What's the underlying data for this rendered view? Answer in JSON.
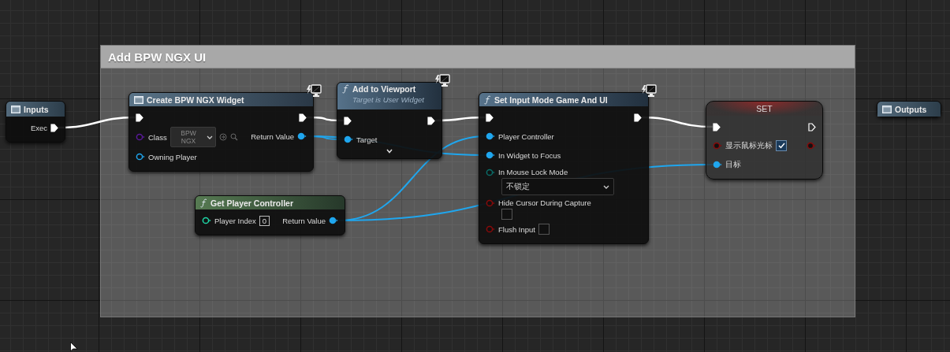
{
  "comment": {
    "title": "Add BPW NGX UI"
  },
  "nodes": [
    {
      "kind": "tunnel",
      "title": "Inputs",
      "net_icon": false,
      "outputs": [
        {
          "kind": "exec",
          "label": "Exec",
          "connected": true
        }
      ]
    },
    {
      "kind": "create_widget",
      "title": "Create BPW NGX Widget",
      "net_icon": true,
      "inputs": [
        {
          "kind": "exec",
          "connected": true
        },
        {
          "kind": "class",
          "label": "Class",
          "connected": false,
          "control": {
            "kind": "dropdown",
            "value": "BPW NGX"
          }
        },
        {
          "kind": "object",
          "label": "Owning Player",
          "connected": false
        }
      ],
      "outputs": [
        {
          "kind": "exec",
          "connected": true
        },
        {
          "kind": "object",
          "label": "Return Value",
          "connected": true
        }
      ]
    },
    {
      "kind": "function",
      "title": "Add to Viewport",
      "subtitle": "Target is User Widget",
      "net_icon": true,
      "advanced_hidden": true,
      "inputs": [
        {
          "kind": "exec",
          "connected": true
        },
        {
          "kind": "object",
          "label": "Target",
          "connected": true
        }
      ],
      "outputs": [
        {
          "kind": "exec",
          "connected": true
        }
      ]
    },
    {
      "kind": "pure_function",
      "title": "Get Player Controller",
      "net_icon": false,
      "inputs": [
        {
          "kind": "int",
          "label": "Player Index",
          "connected": false,
          "control": {
            "kind": "number",
            "value": "0"
          }
        }
      ],
      "outputs": [
        {
          "kind": "object",
          "label": "Return Value",
          "connected": true
        }
      ]
    },
    {
      "kind": "function",
      "title": "Set Input Mode Game And UI",
      "net_icon": true,
      "inputs": [
        {
          "kind": "exec",
          "connected": true
        },
        {
          "kind": "object",
          "label": "Player Controller",
          "connected": true
        },
        {
          "kind": "object",
          "label": "In Widget to Focus",
          "connected": true
        },
        {
          "kind": "byte",
          "label": "In Mouse Lock Mode",
          "connected": false,
          "control": {
            "kind": "dropdown",
            "value": "不锁定"
          }
        },
        {
          "kind": "bool",
          "label": "Hide Cursor During Capture",
          "connected": false,
          "control": {
            "kind": "checkbox",
            "checked": false
          }
        },
        {
          "kind": "bool",
          "label": "Flush Input",
          "connected": false,
          "control": {
            "kind": "checkbox",
            "checked": false
          }
        }
      ],
      "outputs": [
        {
          "kind": "exec",
          "connected": true
        }
      ]
    },
    {
      "kind": "set",
      "title": "SET",
      "net_icon": false,
      "inputs": [
        {
          "kind": "exec",
          "connected": true
        },
        {
          "kind": "bool",
          "label": "显示鼠标光标",
          "connected": false,
          "control": {
            "kind": "checkbox",
            "checked": true
          }
        },
        {
          "kind": "object",
          "label": "目标",
          "connected": true
        }
      ],
      "outputs": [
        {
          "kind": "exec",
          "connected": false
        },
        {
          "kind": "bool",
          "connected": false
        }
      ]
    },
    {
      "kind": "tunnel",
      "title": "Outputs",
      "net_icon": false
    }
  ]
}
